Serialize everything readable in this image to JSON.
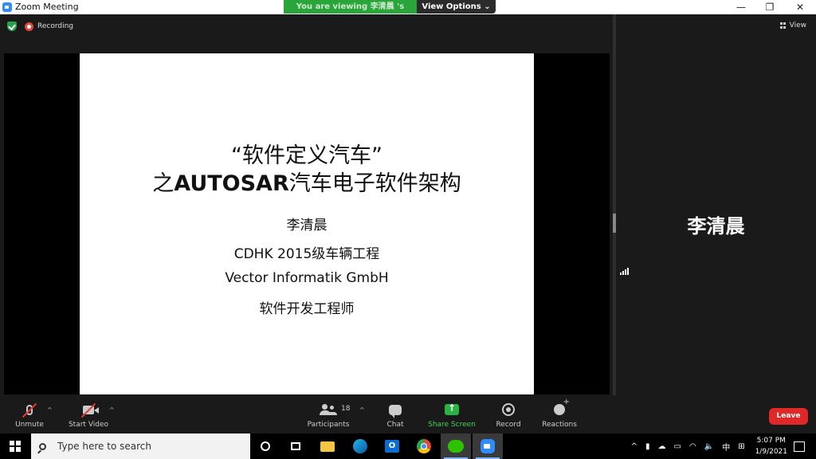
{
  "window": {
    "title": "Zoom Meeting",
    "minimize": "—",
    "restore": "❐",
    "close": "✕"
  },
  "banner": {
    "viewing_text": "You are viewing 李清晨 's screen",
    "view_options": "View Options ⌄"
  },
  "status": {
    "recording": "Recording"
  },
  "slide": {
    "title_line1": "“软件定义汽车”",
    "title_line2_prefix": "之",
    "title_line2_bold": "AUTOSAR",
    "title_line2_suffix": "汽车电子软件架构",
    "author": "李清晨",
    "affiliation": "CDHK 2015级车辆工程",
    "company": "Vector Informatik GmbH",
    "role": "软件开发工程师"
  },
  "gallery": {
    "view_label": "View",
    "participant_name": "李清晨"
  },
  "toolbar": {
    "unmute": "Unmute",
    "start_video": "Start Video",
    "participants": "Participants",
    "participant_count": "18",
    "chat": "Chat",
    "share_screen": "Share Screen",
    "record": "Record",
    "reactions": "Reactions",
    "leave": "Leave",
    "caret": "^"
  },
  "taskbar": {
    "search_placeholder": "Type here to search",
    "time": "5:07 PM",
    "date": "1/9/2021",
    "ime": "中",
    "tray_up": "^",
    "volume": "🔈"
  },
  "colors": {
    "share_green": "#28b342",
    "leave_red": "#e02828",
    "banner_green": "#2aa53a",
    "zoom_blue": "#2d8cff"
  }
}
